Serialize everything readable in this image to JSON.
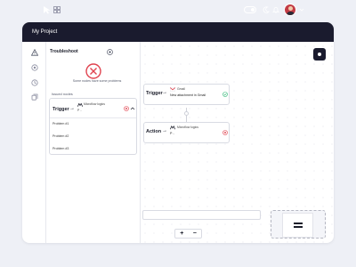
{
  "app": {
    "title": "My Project"
  },
  "panel": {
    "title": "Troubleshoot",
    "problem_text": "Some nodes have some problems",
    "issued_label": "Issued nodes",
    "issue": {
      "label": "Trigger",
      "arrow": "→",
      "app_name": "Microflow logics",
      "app_sub": "P ..",
      "problems": [
        "Problem #1",
        "Problem #2",
        "Problem #3"
      ]
    }
  },
  "canvas": {
    "nodes": [
      {
        "label": "Trigger",
        "arrow": "→",
        "app_name": "Gmail",
        "description": "New attachment in Gmail",
        "status": "ok",
        "icon": "gmail-icon"
      },
      {
        "label": "Action",
        "arrow": "→",
        "app_name": "Microflow logics",
        "description": "P ..",
        "status": "error",
        "icon": "microflow-icon"
      }
    ]
  },
  "zoom": {
    "in_label": "+",
    "out_label": "−"
  },
  "colors": {
    "topbar": "#1a1b2e",
    "error": "#e0434f",
    "success": "#2bb673",
    "accent": "#1a1b2e"
  }
}
